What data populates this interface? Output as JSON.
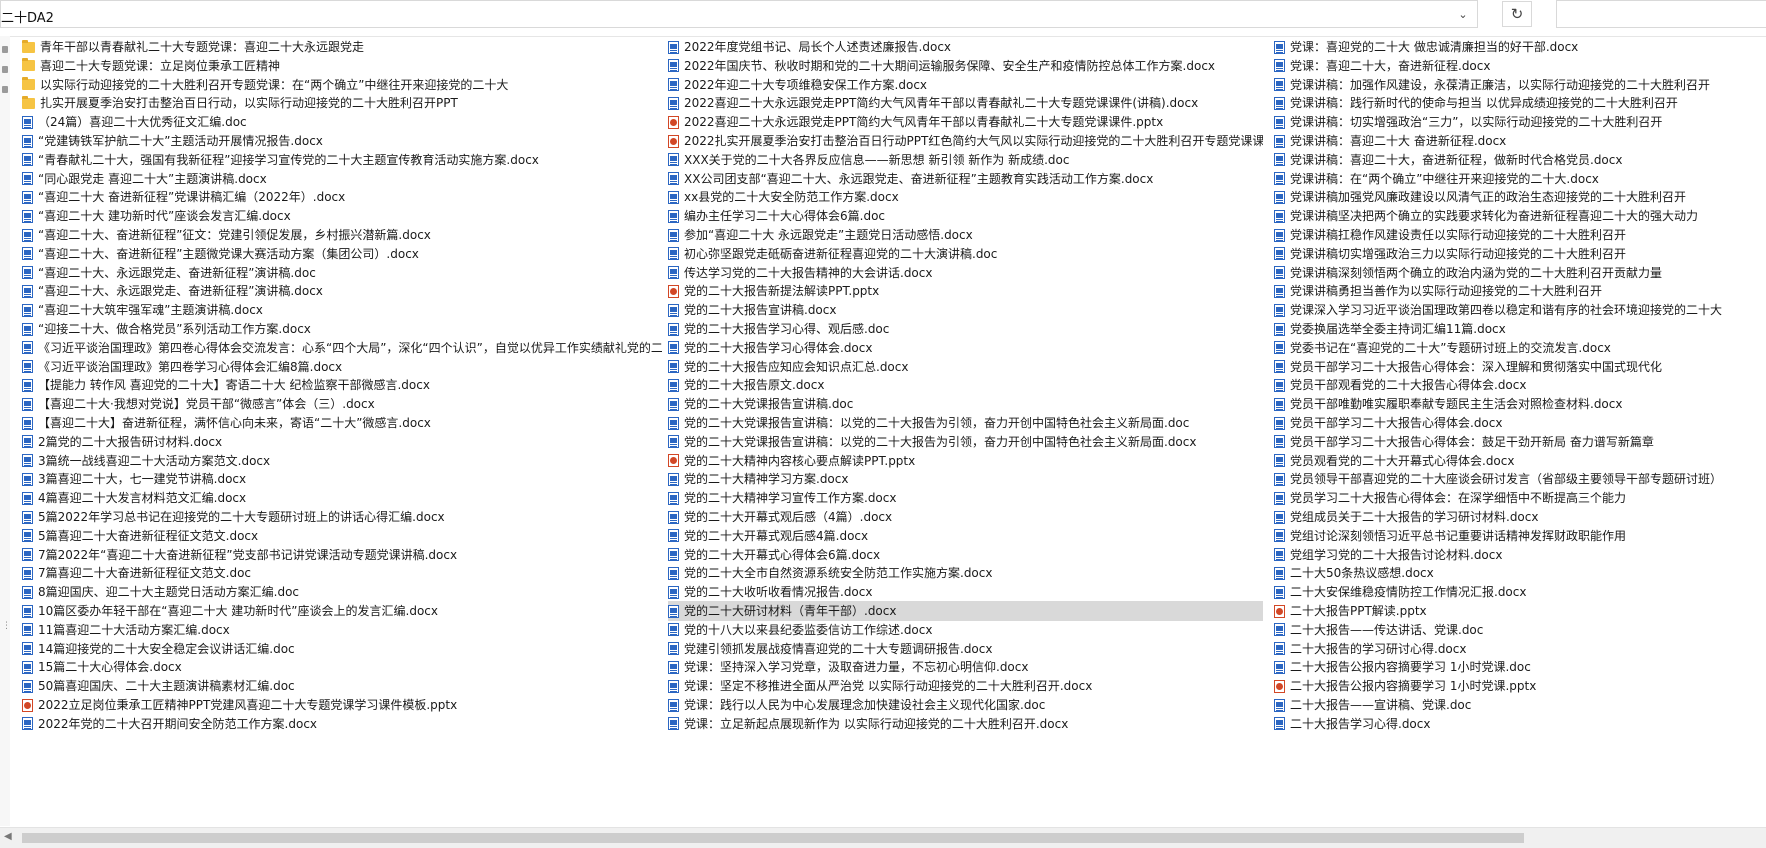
{
  "address": {
    "path": "二十DA2"
  },
  "icons": {
    "dropdown": "chevron-down-icon",
    "refresh": "refresh-icon",
    "search": "search-icon"
  },
  "colors": {
    "folder": "#f6c443",
    "word": "#2b66c2",
    "powerpoint": "#d24726",
    "selected": "#d9d9d9"
  },
  "columns": [
    {
      "items": [
        {
          "t": "folder",
          "n": "青年干部以青春献礼二十大专题党课：喜迎二十大永远跟党走"
        },
        {
          "t": "folder",
          "n": "喜迎二十大专题党课：立足岗位秉承工匠精神"
        },
        {
          "t": "folder",
          "n": "以实际行动迎接党的二十大胜利召开专题党课：在“两个确立”中继往开来迎接党的二十大"
        },
        {
          "t": "folder",
          "n": "扎实开展夏季治安打击整治百日行动，以实际行动迎接党的二十大胜利召开PPT"
        },
        {
          "t": "doc",
          "n": "（24篇）喜迎二十大优秀征文汇编.doc"
        },
        {
          "t": "doc",
          "n": "“党建铸铁军护航二十大”主题活动开展情况报告.docx"
        },
        {
          "t": "doc",
          "n": "“青春献礼二十大，强国有我新征程”迎接学习宣传党的二十大主题宣传教育活动实施方案.docx"
        },
        {
          "t": "doc",
          "n": "“同心跟党走 喜迎二十大”主题演讲稿.docx"
        },
        {
          "t": "doc",
          "n": "“喜迎二十大 奋进新征程”党课讲稿汇编（2022年）.docx"
        },
        {
          "t": "doc",
          "n": "“喜迎二十大 建功新时代”座谈会发言汇编.docx"
        },
        {
          "t": "doc",
          "n": "“喜迎二十大、奋进新征程”征文：党建引领促发展，乡村振兴潜新篇.docx"
        },
        {
          "t": "doc",
          "n": "“喜迎二十大、奋进新征程”主题微党课大赛活动方案（集团公司）.docx"
        },
        {
          "t": "doc",
          "n": "“喜迎二十大、永远跟党走、奋进新征程”演讲稿.doc"
        },
        {
          "t": "doc",
          "n": "“喜迎二十大、永远跟党走、奋进新征程”演讲稿.docx"
        },
        {
          "t": "doc",
          "n": "“喜迎二十大筑牢强军魂”主题演讲稿.docx"
        },
        {
          "t": "doc",
          "n": "“迎接二十大、做合格党员”系列活动工作方案.docx"
        },
        {
          "t": "doc",
          "n": "《习近平谈治国理政》第四卷心得体会交流发言：心系“四个大局”，深化“四个认识”，自觉以优异工作实绩献礼党的二十大！.docx"
        },
        {
          "t": "doc",
          "n": "《习近平谈治国理政》第四卷学习心得体会汇编8篇.docx"
        },
        {
          "t": "doc",
          "n": "【提能力 转作风 喜迎党的二十大】寄语二十大 纪检监察干部微感言.docx"
        },
        {
          "t": "doc",
          "n": "【喜迎二十大·我想对党说】党员干部“微感言”体会（三）.docx"
        },
        {
          "t": "doc",
          "n": "【喜迎二十大】奋进新征程，满怀信心向未来，寄语“二十大”微感言.docx"
        },
        {
          "t": "doc",
          "n": "2篇党的二十大报告研讨材料.docx"
        },
        {
          "t": "doc",
          "n": "3篇统一战线喜迎二十大活动方案范文.docx"
        },
        {
          "t": "doc",
          "n": "3篇喜迎二十大，七一建党节讲稿.docx"
        },
        {
          "t": "doc",
          "n": "4篇喜迎二十大发言材料范文汇编.docx"
        },
        {
          "t": "doc",
          "n": "5篇2022年学习总书记在迎接党的二十大专题研讨班上的讲话心得汇编.docx"
        },
        {
          "t": "doc",
          "n": "5篇喜迎二十大奋进新征程征文范文.docx"
        },
        {
          "t": "doc",
          "n": "7篇2022年“喜迎二十大奋进新征程”党支部书记讲党课活动专题党课讲稿.docx"
        },
        {
          "t": "doc",
          "n": "7篇喜迎二十大奋进新征程征文范文.doc"
        },
        {
          "t": "doc",
          "n": "8篇迎国庆、迎二十大主题党日活动方案汇编.doc"
        },
        {
          "t": "doc",
          "n": "10篇区委办年轻干部在“喜迎二十大 建功新时代”座谈会上的发言汇编.docx"
        },
        {
          "t": "doc",
          "n": "11篇喜迎二十大活动方案汇编.docx"
        },
        {
          "t": "doc",
          "n": "14篇迎接党的二十大安全稳定会议讲话汇编.doc"
        },
        {
          "t": "doc",
          "n": "15篇二十大心得体会.docx"
        },
        {
          "t": "doc",
          "n": "50篇喜迎国庆、二十大主题演讲稿素材汇编.doc"
        },
        {
          "t": "ppt",
          "n": "2022立足岗位秉承工匠精神PPT党建风喜迎二十大专题党课学习课件模板.pptx"
        },
        {
          "t": "doc",
          "n": "2022年党的二十大召开期间安全防范工作方案.docx"
        }
      ]
    },
    {
      "items": [
        {
          "t": "doc",
          "n": "2022年度党组书记、局长个人述责述廉报告.docx"
        },
        {
          "t": "doc",
          "n": "2022年国庆节、秋收时期和党的二十大期间运输服务保障、安全生产和疫情防控总体工作方案.docx"
        },
        {
          "t": "doc",
          "n": "2022年迎二十大专项维稳安保工作方案.docx"
        },
        {
          "t": "doc",
          "n": "2022喜迎二十大永远跟党走PPT简约大气风青年干部以青春献礼二十大专题党课课件(讲稿).docx"
        },
        {
          "t": "ppt",
          "n": "2022喜迎二十大永远跟党走PPT简约大气风青年干部以青春献礼二十大专题党课课件.pptx"
        },
        {
          "t": "ppt",
          "n": "2022扎实开展夏季治安打击整治百日行动PPT红色简约大气风以实际行动迎接党的二十大胜利召开专题党课课件模板.pptx"
        },
        {
          "t": "doc",
          "n": "XXX关于党的二十大各界反应信息——新思想 新引领 新作为 新成绩.doc"
        },
        {
          "t": "doc",
          "n": "XX公司团支部“喜迎二十大、永远跟党走、奋进新征程”主题教育实践活动工作方案.docx"
        },
        {
          "t": "doc",
          "n": "xx县党的二十大安全防范工作方案.docx"
        },
        {
          "t": "doc",
          "n": "编办主任学习二十大心得体会6篇.doc"
        },
        {
          "t": "doc",
          "n": "参加“喜迎二十大 永远跟党走”主题党日活动感悟.docx"
        },
        {
          "t": "doc",
          "n": "初心弥坚跟党走砥砺奋进新征程喜迎党的二十大演讲稿.doc"
        },
        {
          "t": "doc",
          "n": "传达学习党的二十大报告精神的大会讲话.docx"
        },
        {
          "t": "ppt",
          "n": "党的二十大报告新提法解读PPT.pptx"
        },
        {
          "t": "doc",
          "n": "党的二十大报告宣讲稿.docx"
        },
        {
          "t": "doc",
          "n": "党的二十大报告学习心得、观后感.doc"
        },
        {
          "t": "doc",
          "n": "党的二十大报告学习心得体会.docx"
        },
        {
          "t": "doc",
          "n": "党的二十大报告应知应会知识点汇总.docx"
        },
        {
          "t": "doc",
          "n": "党的二十大报告原文.docx"
        },
        {
          "t": "doc",
          "n": "党的二十大党课报告宣讲稿.doc"
        },
        {
          "t": "doc",
          "n": "党的二十大党课报告宣讲稿：以党的二十大报告为引领，奋力开创中国特色社会主义新局面.doc"
        },
        {
          "t": "doc",
          "n": "党的二十大党课报告宣讲稿：以党的二十大报告为引领，奋力开创中国特色社会主义新局面.docx"
        },
        {
          "t": "ppt",
          "n": "党的二十大精神内容核心要点解读PPT.pptx"
        },
        {
          "t": "doc",
          "n": "党的二十大精神学习方案.docx"
        },
        {
          "t": "doc",
          "n": "党的二十大精神学习宣传工作方案.docx"
        },
        {
          "t": "doc",
          "n": "党的二十大开幕式观后感（4篇）.docx"
        },
        {
          "t": "doc",
          "n": "党的二十大开幕式观后感4篇.docx"
        },
        {
          "t": "doc",
          "n": "党的二十大开幕式心得体会6篇.docx"
        },
        {
          "t": "doc",
          "n": "党的二十大全市自然资源系统安全防范工作实施方案.docx"
        },
        {
          "t": "doc",
          "n": "党的二十大收听收看情况报告.docx"
        },
        {
          "t": "doc",
          "n": "党的二十大研讨材料（青年干部）.docx",
          "sel": true
        },
        {
          "t": "doc",
          "n": "党的十八大以来县纪委监委信访工作综述.docx"
        },
        {
          "t": "doc",
          "n": "党建引领抓发展战疫情喜迎党的二十大专题调研报告.docx"
        },
        {
          "t": "doc",
          "n": "党课：坚持深入学习党章，汲取奋进力量，不忘初心明信仰.docx"
        },
        {
          "t": "doc",
          "n": "党课：坚定不移推进全面从严治党 以实际行动迎接党的二十大胜利召开.docx"
        },
        {
          "t": "doc",
          "n": "党课：践行以人民为中心发展理念加快建设社会主义现代化国家.doc"
        },
        {
          "t": "doc",
          "n": "党课：立足新起点展现新作为 以实际行动迎接党的二十大胜利召开.docx"
        }
      ]
    },
    {
      "items": [
        {
          "t": "doc",
          "n": "党课：喜迎党的二十大 做忠诚清廉担当的好干部.docx"
        },
        {
          "t": "doc",
          "n": "党课：喜迎二十大，奋进新征程.docx"
        },
        {
          "t": "doc",
          "n": "党课讲稿：加强作风建设，永葆清正廉洁，以实际行动迎接党的二十大胜利召开"
        },
        {
          "t": "doc",
          "n": "党课讲稿：践行新时代的使命与担当 以优异成绩迎接党的二十大胜利召开"
        },
        {
          "t": "doc",
          "n": "党课讲稿：切实增强政治“三力”，以实际行动迎接党的二十大胜利召开"
        },
        {
          "t": "doc",
          "n": "党课讲稿：喜迎二十大 奋进新征程.docx"
        },
        {
          "t": "doc",
          "n": "党课讲稿：喜迎二十大，奋进新征程，做新时代合格党员.docx"
        },
        {
          "t": "doc",
          "n": "党课讲稿：在“两个确立”中继往开来迎接党的二十大.docx"
        },
        {
          "t": "doc",
          "n": "党课讲稿加强党风廉政建设以风清气正的政治生态迎接党的二十大胜利召开"
        },
        {
          "t": "doc",
          "n": "党课讲稿坚决把两个确立的实践要求转化为奋进新征程喜迎二十大的强大动力"
        },
        {
          "t": "doc",
          "n": "党课讲稿扛稳作风建设责任以实际行动迎接党的二十大胜利召开"
        },
        {
          "t": "doc",
          "n": "党课讲稿切实增强政治三力以实际行动迎接党的二十大胜利召开"
        },
        {
          "t": "doc",
          "n": "党课讲稿深刻领悟两个确立的政治内涵为党的二十大胜利召开贡献力量"
        },
        {
          "t": "doc",
          "n": "党课讲稿勇担当善作为以实际行动迎接党的二十大胜利召开"
        },
        {
          "t": "doc",
          "n": "党课深入学习习近平谈治国理政第四卷以稳定和谐有序的社会环境迎接党的二十大"
        },
        {
          "t": "doc",
          "n": "党委换届选举全委主持词汇编11篇.docx"
        },
        {
          "t": "doc",
          "n": "党委书记在“喜迎党的二十大”专题研讨班上的交流发言.docx"
        },
        {
          "t": "doc",
          "n": "党员干部学习二十大报告心得体会：深入理解和贯彻落实中国式现代化"
        },
        {
          "t": "doc",
          "n": "党员干部观看党的二十大报告心得体会.docx"
        },
        {
          "t": "doc",
          "n": "党员干部唯勤唯实履职奉献专题民主生活会对照检查材料.docx"
        },
        {
          "t": "doc",
          "n": "党员干部学习二十大报告心得体会.docx"
        },
        {
          "t": "doc",
          "n": "党员干部学习二十大报告心得体会：鼓足干劲开新局 奋力谱写新篇章"
        },
        {
          "t": "doc",
          "n": "党员观看党的二十大开幕式心得体会.docx"
        },
        {
          "t": "doc",
          "n": "党员领导干部喜迎党的二十大座谈会研讨发言（省部级主要领导干部专题研讨班）"
        },
        {
          "t": "doc",
          "n": "党员学习二十大报告心得体会：在深学细悟中不断提高三个能力"
        },
        {
          "t": "doc",
          "n": "党组成员关于二十大报告的学习研讨材料.docx"
        },
        {
          "t": "doc",
          "n": "党组讨论深刻领悟习近平总书记重要讲话精神发挥财政职能作用"
        },
        {
          "t": "doc",
          "n": "党组学习党的二十大报告讨论材料.docx"
        },
        {
          "t": "doc",
          "n": "二十大50条热议感想.docx"
        },
        {
          "t": "doc",
          "n": "二十大安保维稳疫情防控工作情况汇报.docx"
        },
        {
          "t": "ppt",
          "n": "二十大报告PPT解读.pptx"
        },
        {
          "t": "doc",
          "n": "二十大报告——传达讲话、党课.doc"
        },
        {
          "t": "doc",
          "n": "二十大报告的学习研讨心得.docx"
        },
        {
          "t": "doc",
          "n": "二十大报告公报内容摘要学习 1小时党课.doc"
        },
        {
          "t": "ppt",
          "n": "二十大报告公报内容摘要学习 1小时党课.pptx"
        },
        {
          "t": "doc",
          "n": "二十大报告——宣讲稿、党课.doc"
        },
        {
          "t": "doc",
          "n": "二十大报告学习心得.docx"
        }
      ]
    }
  ]
}
